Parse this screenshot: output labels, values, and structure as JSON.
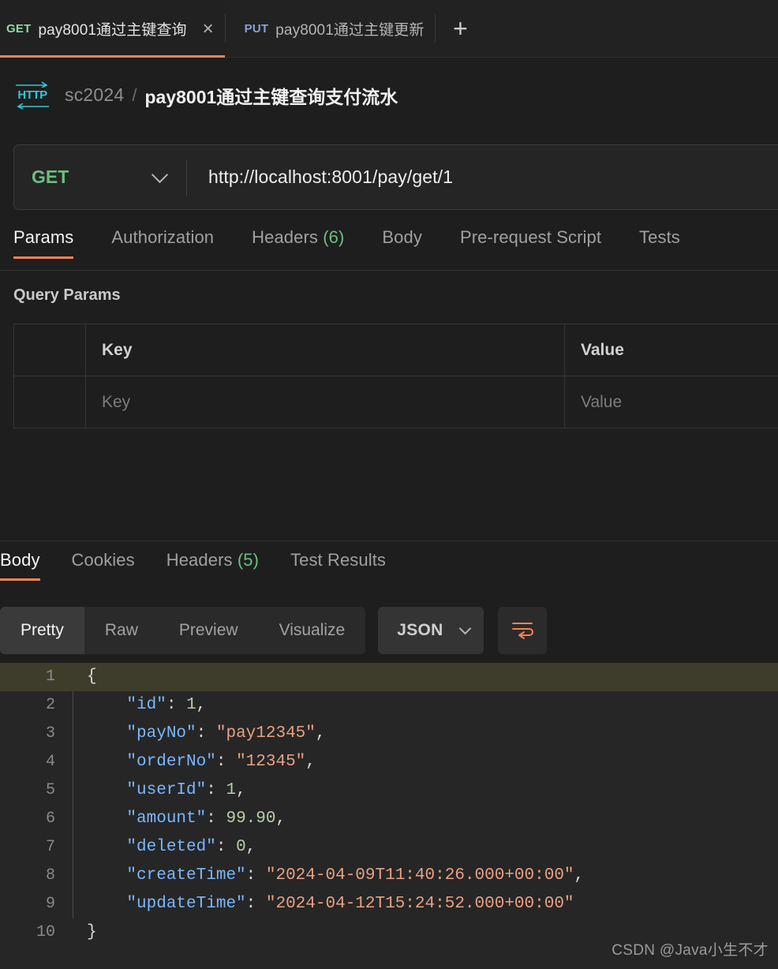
{
  "tabstrip": {
    "tabs": [
      {
        "method": "GET",
        "title": "pay8001通过主键查询",
        "active": true,
        "close_icon": "×"
      },
      {
        "method": "PUT",
        "title": "pay8001通过主键更新",
        "active": false
      }
    ],
    "new_tab_label": "+"
  },
  "breadcrumb": {
    "protocol_icon": "HTTP",
    "collection": "sc2024",
    "separator": "/",
    "request_name": "pay8001通过主键查询支付流水"
  },
  "url_bar": {
    "method": "GET",
    "url": "http://localhost:8001/pay/get/1",
    "chevron_icon": "chevron-down-icon"
  },
  "request_tabs": [
    {
      "label": "Params",
      "active": true
    },
    {
      "label": "Authorization",
      "active": false
    },
    {
      "label": "Headers",
      "count": "(6)",
      "active": false
    },
    {
      "label": "Body",
      "active": false
    },
    {
      "label": "Pre-request Script",
      "active": false
    },
    {
      "label": "Tests",
      "active": false
    }
  ],
  "query_params": {
    "section_title": "Query Params",
    "headers": {
      "key": "Key",
      "value": "Value"
    },
    "rows": [
      {
        "key_placeholder": "Key",
        "value_placeholder": "Value"
      }
    ]
  },
  "response_tabs": [
    {
      "label": "Body",
      "active": true
    },
    {
      "label": "Cookies",
      "active": false
    },
    {
      "label": "Headers",
      "count": "(5)",
      "active": false
    },
    {
      "label": "Test Results",
      "active": false
    }
  ],
  "body_toolbar": {
    "view_modes": [
      {
        "label": "Pretty",
        "active": true
      },
      {
        "label": "Raw",
        "active": false
      },
      {
        "label": "Preview",
        "active": false
      },
      {
        "label": "Visualize",
        "active": false
      }
    ],
    "format": "JSON",
    "wrap_icon": "word-wrap-icon"
  },
  "response_body": {
    "lines": [
      {
        "num": "1",
        "highlighted": true,
        "fold": false,
        "tokens": [
          {
            "t": "p",
            "v": "{"
          }
        ]
      },
      {
        "num": "2",
        "highlighted": false,
        "fold": true,
        "tokens": [
          {
            "t": "p",
            "v": "    "
          },
          {
            "t": "k",
            "v": "\"id\""
          },
          {
            "t": "p",
            "v": ": "
          },
          {
            "t": "n",
            "v": "1"
          },
          {
            "t": "p",
            "v": ","
          }
        ]
      },
      {
        "num": "3",
        "highlighted": false,
        "fold": true,
        "tokens": [
          {
            "t": "p",
            "v": "    "
          },
          {
            "t": "k",
            "v": "\"payNo\""
          },
          {
            "t": "p",
            "v": ": "
          },
          {
            "t": "s",
            "v": "\"pay12345\""
          },
          {
            "t": "p",
            "v": ","
          }
        ]
      },
      {
        "num": "4",
        "highlighted": false,
        "fold": true,
        "tokens": [
          {
            "t": "p",
            "v": "    "
          },
          {
            "t": "k",
            "v": "\"orderNo\""
          },
          {
            "t": "p",
            "v": ": "
          },
          {
            "t": "s",
            "v": "\"12345\""
          },
          {
            "t": "p",
            "v": ","
          }
        ]
      },
      {
        "num": "5",
        "highlighted": false,
        "fold": true,
        "tokens": [
          {
            "t": "p",
            "v": "    "
          },
          {
            "t": "k",
            "v": "\"userId\""
          },
          {
            "t": "p",
            "v": ": "
          },
          {
            "t": "n",
            "v": "1"
          },
          {
            "t": "p",
            "v": ","
          }
        ]
      },
      {
        "num": "6",
        "highlighted": false,
        "fold": true,
        "tokens": [
          {
            "t": "p",
            "v": "    "
          },
          {
            "t": "k",
            "v": "\"amount\""
          },
          {
            "t": "p",
            "v": ": "
          },
          {
            "t": "n",
            "v": "99.90"
          },
          {
            "t": "p",
            "v": ","
          }
        ]
      },
      {
        "num": "7",
        "highlighted": false,
        "fold": true,
        "tokens": [
          {
            "t": "p",
            "v": "    "
          },
          {
            "t": "k",
            "v": "\"deleted\""
          },
          {
            "t": "p",
            "v": ": "
          },
          {
            "t": "n",
            "v": "0"
          },
          {
            "t": "p",
            "v": ","
          }
        ]
      },
      {
        "num": "8",
        "highlighted": false,
        "fold": true,
        "tokens": [
          {
            "t": "p",
            "v": "    "
          },
          {
            "t": "k",
            "v": "\"createTime\""
          },
          {
            "t": "p",
            "v": ": "
          },
          {
            "t": "s",
            "v": "\"2024-04-09T11:40:26.000+00:00\""
          },
          {
            "t": "p",
            "v": ","
          }
        ]
      },
      {
        "num": "9",
        "highlighted": false,
        "fold": true,
        "tokens": [
          {
            "t": "p",
            "v": "    "
          },
          {
            "t": "k",
            "v": "\"updateTime\""
          },
          {
            "t": "p",
            "v": ": "
          },
          {
            "t": "s",
            "v": "\"2024-04-12T15:24:52.000+00:00\""
          }
        ]
      },
      {
        "num": "10",
        "highlighted": false,
        "fold": false,
        "tokens": [
          {
            "t": "p",
            "v": "}"
          }
        ]
      }
    ]
  },
  "watermark": "CSDN @Java小生不才",
  "colors": {
    "accent_orange": "#ef8354",
    "method_get_green": "#6bbf7f",
    "method_put_blue": "#8b9fd6",
    "count_green": "#6bbf7f",
    "http_icon_cyan": "#36c5d6",
    "json_key_blue": "#79b8ff",
    "json_string_salmon": "#e8a183",
    "json_number_green": "#b5cea8",
    "highlight_line": "#3e3d2c"
  }
}
